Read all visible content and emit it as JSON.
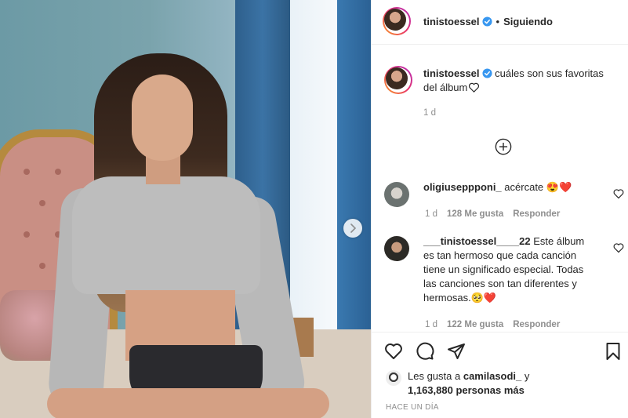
{
  "post": {
    "username": "tinistoessel",
    "follow_status": "Siguiendo",
    "separator": "•",
    "caption_text": "cuáles son sus favoritas del álbum",
    "caption_time": "1 d"
  },
  "comments": [
    {
      "username": "oligiuseppponi_",
      "text": "acércate",
      "emoji": "😍❤️",
      "time": "1 d",
      "likes": "128 Me gusta",
      "reply": "Responder"
    },
    {
      "username": "___tinistoessel____22",
      "text": "Este álbum es tan hermoso que cada canción tiene un significado especial. Todas las canciones son tan diferentes y hermosas.",
      "emoji": "🥺❤️",
      "time": "1 d",
      "likes": "122 Me gusta",
      "reply": "Responder"
    }
  ],
  "likes_block": {
    "prefix": "Les gusta a",
    "user": "camilasodi_",
    "suffix": "y",
    "count_line": "1,163,880 personas más"
  },
  "time_ago": "HACE UN DÍA",
  "icons": {
    "verified": "verified-badge-icon",
    "next": "chevron-right-icon",
    "load_more": "plus-circle-icon",
    "like": "heart-icon",
    "comment": "speech-bubble-icon",
    "share": "paper-plane-icon",
    "save": "bookmark-icon"
  },
  "colors": {
    "verified_blue": "#3897f0",
    "emoji_heart": "#ed4956",
    "muted_text": "#8e8e8e",
    "text": "#262626"
  }
}
